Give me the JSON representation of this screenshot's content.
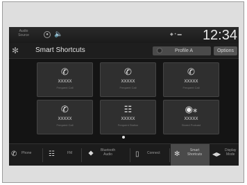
{
  "status": {
    "source_label": [
      "Audio",
      "Source"
    ],
    "clock": "12:34"
  },
  "titlebar": {
    "title": "Smart Shortcuts",
    "profile_label": "Profile A",
    "options_label": "Options"
  },
  "shortcuts": [
    {
      "icon": "phone-icon",
      "name": "XXXXX",
      "sub": "Frequent Call"
    },
    {
      "icon": "phone-icon",
      "name": "XXXXX",
      "sub": "Frequent Call"
    },
    {
      "icon": "phone-icon",
      "name": "XXXXX",
      "sub": "Frequent Call"
    },
    {
      "icon": "phone-icon",
      "name": "XXXXX",
      "sub": "Frequent Call"
    },
    {
      "icon": "radio-station-icon",
      "name": "XXXXX",
      "sub": "Frequent Station"
    },
    {
      "icon": "voice-memo-icon",
      "name": "XXXXX",
      "sub": "Stored Podcast"
    }
  ],
  "nav": {
    "phone": "Phone",
    "fm": "FM",
    "bluetooth": [
      "Bluetooth",
      "Audio"
    ],
    "connect": "Connect",
    "smart": [
      "Smart",
      "Shortcuts"
    ],
    "display": [
      "Display",
      "Mode"
    ]
  }
}
